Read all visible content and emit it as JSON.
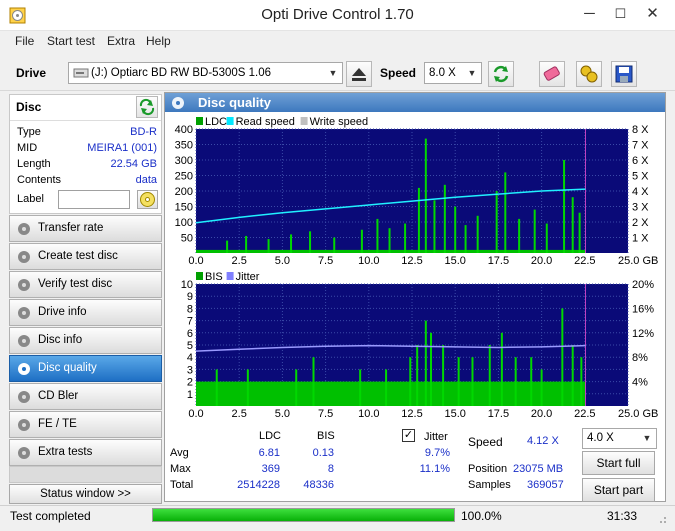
{
  "window": {
    "title": "Opti Drive Control 1.70",
    "minimize": "─",
    "maximize": "☐",
    "close": "✕"
  },
  "menu": [
    "File",
    "Start test",
    "Extra",
    "Help"
  ],
  "toolbar": {
    "drive_label": "Drive",
    "drive_value": "(J:)   Optiarc BD RW BD-5300S 1.06",
    "speed_label": "Speed",
    "speed_value": "8.0 X"
  },
  "disc": {
    "header": "Disc",
    "rows": [
      {
        "label": "Type",
        "value": "BD-R"
      },
      {
        "label": "MID",
        "value": "MEIRA1 (001)"
      },
      {
        "label": "Length",
        "value": "22.54 GB"
      },
      {
        "label": "Contents",
        "value": "data"
      }
    ],
    "label_field": "Label"
  },
  "nav": [
    {
      "label": "Transfer rate",
      "active": false
    },
    {
      "label": "Create test disc",
      "active": false
    },
    {
      "label": "Verify test disc",
      "active": false
    },
    {
      "label": "Drive info",
      "active": false
    },
    {
      "label": "Disc info",
      "active": false
    },
    {
      "label": "Disc quality",
      "active": true
    },
    {
      "label": "CD Bler",
      "active": false
    },
    {
      "label": "FE / TE",
      "active": false
    },
    {
      "label": "Extra tests",
      "active": false
    }
  ],
  "status_window_btn": "Status window >>",
  "panel_title": "Disc quality",
  "chart_data": [
    {
      "type": "bar",
      "legend": [
        "LDC",
        "Read speed",
        "Write speed"
      ],
      "legend_colors": [
        "#00a000",
        "#00e8ff",
        "#c0c0c0"
      ],
      "x_ticks": [
        "0.0",
        "2.5",
        "5.0",
        "7.5",
        "10.0",
        "12.5",
        "15.0",
        "17.5",
        "20.0",
        "22.5",
        "25.0 GB"
      ],
      "y_ticks": [
        "400",
        "350",
        "300",
        "250",
        "200",
        "150",
        "100",
        "50"
      ],
      "y2_ticks": [
        "8 X",
        "7 X",
        "6 X",
        "5 X",
        "4 X",
        "3 X",
        "2 X",
        "1 X"
      ],
      "xlim": [
        0,
        25
      ],
      "ylim": [
        0,
        400
      ],
      "y2lim": [
        0,
        8
      ],
      "data_end": 22.54,
      "ldc_baseline": 10,
      "ldc_spikes": [
        {
          "x": 1.8,
          "y": 40
        },
        {
          "x": 2.9,
          "y": 55
        },
        {
          "x": 4.2,
          "y": 45
        },
        {
          "x": 5.5,
          "y": 60
        },
        {
          "x": 6.6,
          "y": 70
        },
        {
          "x": 8.0,
          "y": 50
        },
        {
          "x": 9.6,
          "y": 75
        },
        {
          "x": 10.5,
          "y": 110
        },
        {
          "x": 11.2,
          "y": 80
        },
        {
          "x": 12.1,
          "y": 95
        },
        {
          "x": 12.9,
          "y": 210
        },
        {
          "x": 13.3,
          "y": 369
        },
        {
          "x": 13.8,
          "y": 170
        },
        {
          "x": 14.4,
          "y": 220
        },
        {
          "x": 15.0,
          "y": 150
        },
        {
          "x": 15.6,
          "y": 90
        },
        {
          "x": 16.3,
          "y": 120
        },
        {
          "x": 17.4,
          "y": 200
        },
        {
          "x": 17.9,
          "y": 260
        },
        {
          "x": 18.7,
          "y": 110
        },
        {
          "x": 19.6,
          "y": 140
        },
        {
          "x": 20.3,
          "y": 95
        },
        {
          "x": 21.3,
          "y": 300
        },
        {
          "x": 21.8,
          "y": 180
        },
        {
          "x": 22.2,
          "y": 130
        }
      ],
      "read_speed": [
        {
          "x": 0,
          "y": 1.95
        },
        {
          "x": 2.5,
          "y": 2.3
        },
        {
          "x": 5.0,
          "y": 2.6
        },
        {
          "x": 7.5,
          "y": 2.85
        },
        {
          "x": 10.0,
          "y": 3.1
        },
        {
          "x": 12.5,
          "y": 3.35
        },
        {
          "x": 15.0,
          "y": 3.6
        },
        {
          "x": 17.5,
          "y": 3.8
        },
        {
          "x": 20.0,
          "y": 4.0
        },
        {
          "x": 22.54,
          "y": 4.12
        }
      ]
    },
    {
      "type": "bar",
      "legend": [
        "BIS",
        "Jitter"
      ],
      "legend_colors": [
        "#00a000",
        "#8080ff"
      ],
      "x_ticks": [
        "0.0",
        "2.5",
        "5.0",
        "7.5",
        "10.0",
        "12.5",
        "15.0",
        "17.5",
        "20.0",
        "22.5",
        "25.0 GB"
      ],
      "y_ticks": [
        "10",
        "9",
        "8",
        "7",
        "6",
        "5",
        "4",
        "3",
        "2",
        "1"
      ],
      "y2_ticks": [
        "20%",
        "16%",
        "12%",
        "8%",
        "4%"
      ],
      "xlim": [
        0,
        25
      ],
      "ylim": [
        0,
        10
      ],
      "y2lim": [
        0,
        20
      ],
      "data_end": 22.54,
      "bis_baseline": 2,
      "bis_spikes": [
        {
          "x": 1.2,
          "y": 3
        },
        {
          "x": 3.0,
          "y": 3
        },
        {
          "x": 5.8,
          "y": 3
        },
        {
          "x": 6.8,
          "y": 4
        },
        {
          "x": 9.5,
          "y": 3
        },
        {
          "x": 11.0,
          "y": 3
        },
        {
          "x": 12.4,
          "y": 4
        },
        {
          "x": 12.8,
          "y": 5
        },
        {
          "x": 13.3,
          "y": 7
        },
        {
          "x": 13.6,
          "y": 6
        },
        {
          "x": 14.3,
          "y": 5
        },
        {
          "x": 15.2,
          "y": 4
        },
        {
          "x": 16.0,
          "y": 4
        },
        {
          "x": 17.0,
          "y": 5
        },
        {
          "x": 17.7,
          "y": 6
        },
        {
          "x": 18.5,
          "y": 4
        },
        {
          "x": 19.4,
          "y": 4
        },
        {
          "x": 20.0,
          "y": 3
        },
        {
          "x": 21.2,
          "y": 8
        },
        {
          "x": 21.8,
          "y": 5
        },
        {
          "x": 22.3,
          "y": 4
        }
      ],
      "jitter": [
        {
          "x": 0,
          "y": 9.0
        },
        {
          "x": 2.5,
          "y": 9.3
        },
        {
          "x": 5.0,
          "y": 9.6
        },
        {
          "x": 7.5,
          "y": 9.8
        },
        {
          "x": 10.0,
          "y": 9.9
        },
        {
          "x": 12.5,
          "y": 9.8
        },
        {
          "x": 15.0,
          "y": 9.7
        },
        {
          "x": 17.5,
          "y": 9.6
        },
        {
          "x": 20.0,
          "y": 9.7
        },
        {
          "x": 22.54,
          "y": 9.9
        }
      ]
    }
  ],
  "stats": {
    "col_ldc": "LDC",
    "col_bis": "BIS",
    "col_jitter": "Jitter",
    "rows": [
      {
        "label": "Avg",
        "ldc": "6.81",
        "bis": "0.13",
        "jitter": "9.7%"
      },
      {
        "label": "Max",
        "ldc": "369",
        "bis": "8",
        "jitter": "11.1%"
      },
      {
        "label": "Total",
        "ldc": "2514228",
        "bis": "48336",
        "jitter": ""
      }
    ],
    "speed_label": "Speed",
    "speed_value": "4.12 X",
    "position_label": "Position",
    "position_value": "23075 MB",
    "samples_label": "Samples",
    "samples_value": "369057",
    "speed_select": "4.0 X",
    "start_full": "Start full",
    "start_part": "Start part"
  },
  "status": {
    "text": "Test completed",
    "progress": 100,
    "progress_text": "100.0%",
    "time": "31:33"
  }
}
